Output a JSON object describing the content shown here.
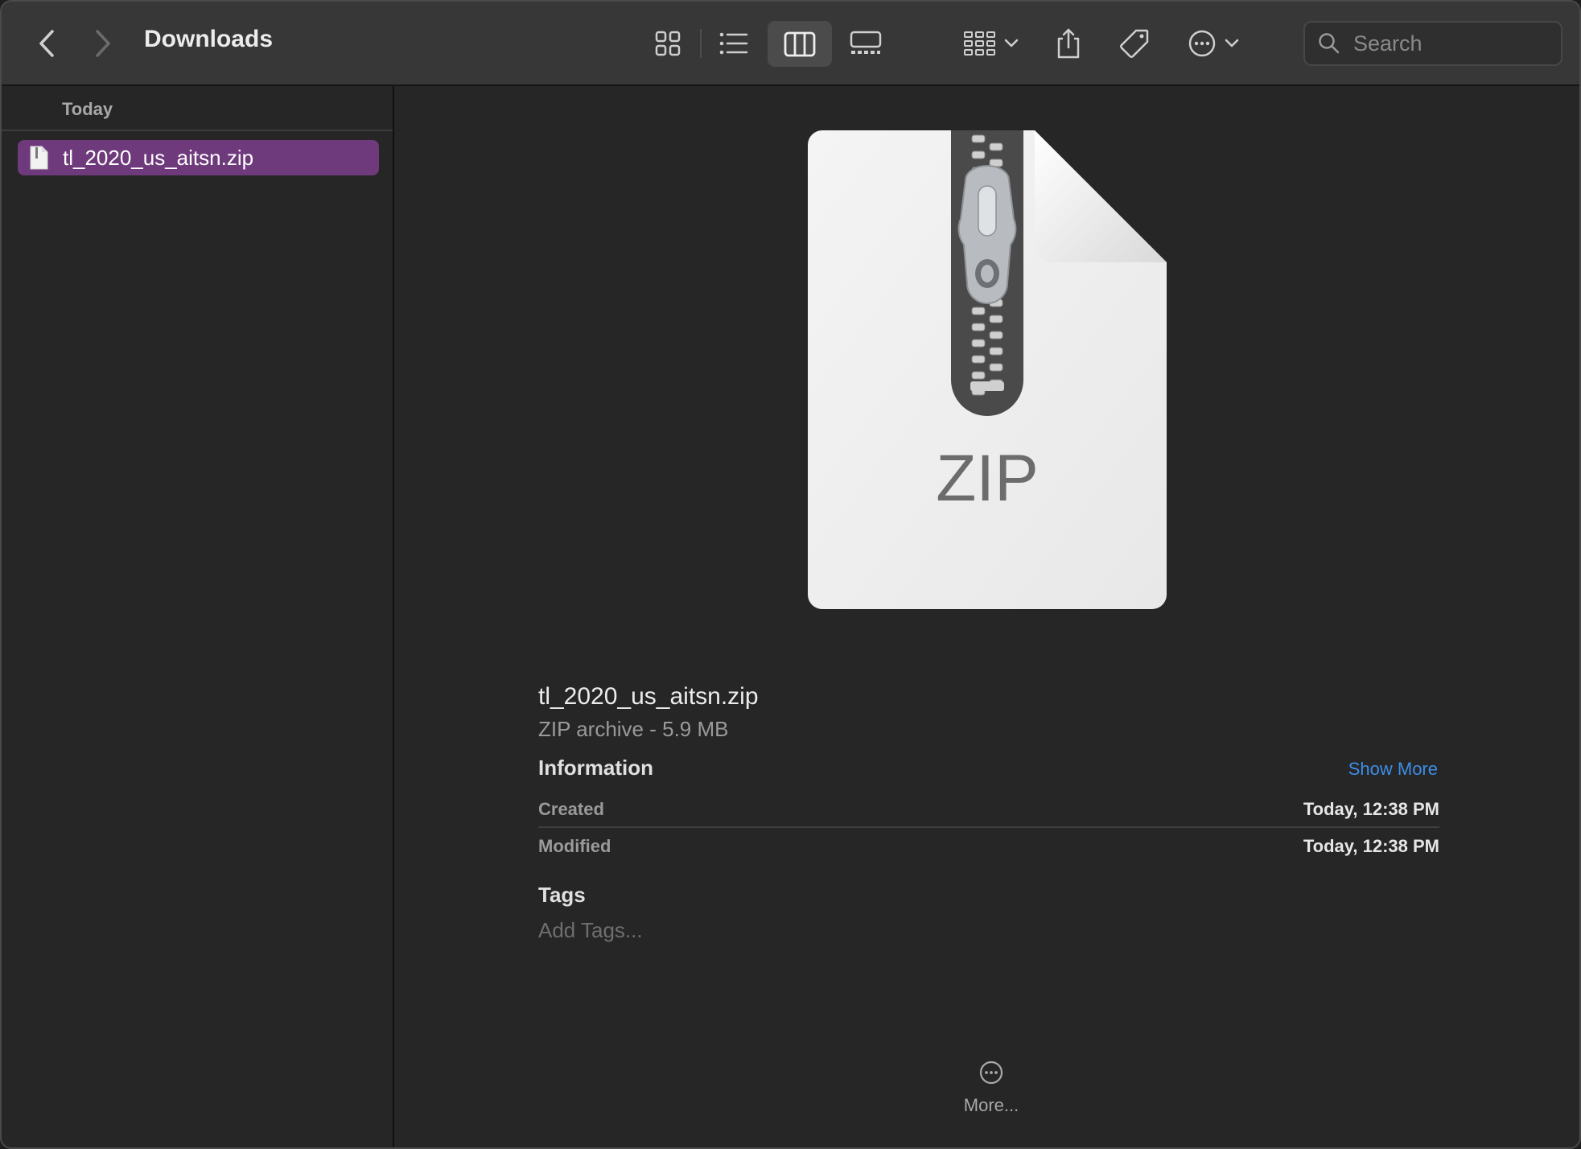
{
  "window": {
    "title": "Downloads"
  },
  "toolbar": {
    "icons": {
      "back": "chevron-left-icon",
      "forward": "chevron-right-icon",
      "icon_view": "grid-icon",
      "list_view": "list-icon",
      "column_view": "columns-icon",
      "gallery_view": "gallery-icon",
      "group": "group-icon",
      "share": "share-icon",
      "tag": "tag-icon",
      "more": "ellipsis-circle-icon"
    },
    "active_view": "columns",
    "search": {
      "placeholder": "Search",
      "value": ""
    }
  },
  "column": {
    "section_label": "Today",
    "items": [
      {
        "name": "tl_2020_us_aitsn.zip",
        "selected": true
      }
    ],
    "selection_color": "#6f3a7c"
  },
  "preview": {
    "icon_text": "ZIP",
    "file_name": "tl_2020_us_aitsn.zip",
    "kind_size": "ZIP archive - 5.9 MB",
    "information_heading": "Information",
    "show_more_label": "Show More",
    "link_color": "#3d8de8",
    "rows": [
      {
        "label": "Created",
        "value": "Today, 12:38 PM"
      },
      {
        "label": "Modified",
        "value": "Today, 12:38 PM"
      }
    ],
    "tags_heading": "Tags",
    "tags_placeholder": "Add Tags...",
    "more_label": "More..."
  }
}
